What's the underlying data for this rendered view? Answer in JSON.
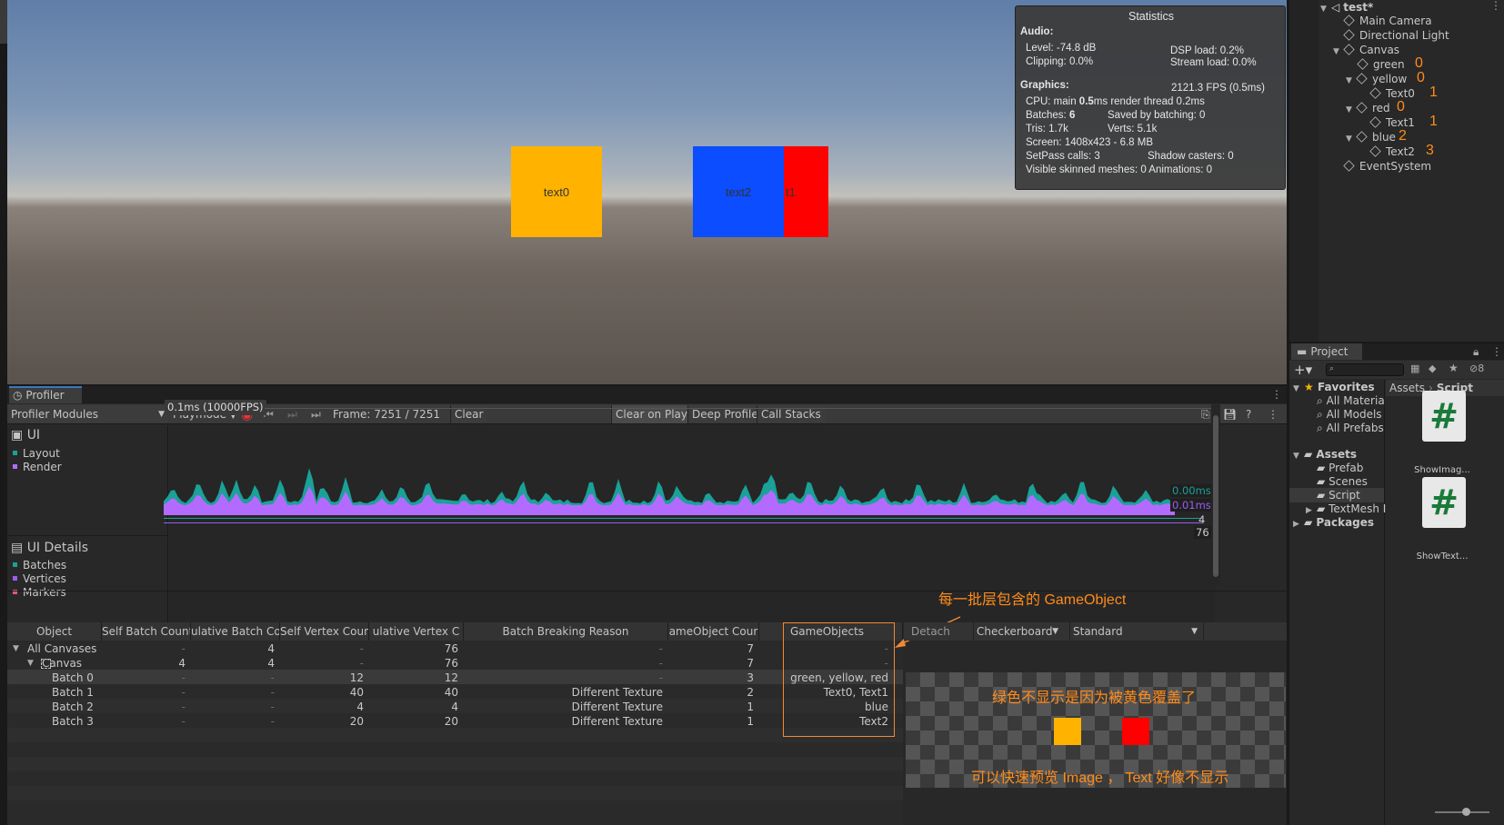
{
  "game": {
    "squares": [
      {
        "label": "text0",
        "color": "#ffb300"
      },
      {
        "label": "text2",
        "color": "#0b4dff"
      },
      {
        "label": "t1",
        "color": "#ff0000"
      }
    ]
  },
  "stats": {
    "title": "Statistics",
    "audio_header": "Audio:",
    "level": "Level: -74.8 dB",
    "clipping": "Clipping: 0.0%",
    "dsp": "DSP load: 0.2%",
    "stream": "Stream load: 0.0%",
    "graphics_header": "Graphics:",
    "fps": "2121.3 FPS (0.5ms)",
    "cpu_prefix": "CPU: main ",
    "cpu_main": "0.5",
    "cpu_suffix": "ms  render thread 0.2ms",
    "batches_prefix": "Batches: ",
    "batches_value": "6",
    "saved": "Saved by batching: 0",
    "tris": "Tris: 1.7k",
    "verts": "Verts: 5.1k",
    "screen": "Screen: 1408x423 - 6.8 MB",
    "setpass": "SetPass calls: 3",
    "shadow": "Shadow casters: 0",
    "skinned": "Visible skinned meshes: 0  Animations: 0"
  },
  "hierarchy": {
    "scene": "test*",
    "items": [
      {
        "label": "Main Camera"
      },
      {
        "label": "Directional Light"
      },
      {
        "label": "Canvas"
      },
      {
        "label": "green",
        "note": "0"
      },
      {
        "label": "yellow",
        "note": "0"
      },
      {
        "label": "Text0",
        "note": "1"
      },
      {
        "label": "red",
        "note": "0"
      },
      {
        "label": "Text1",
        "note": "1"
      },
      {
        "label": "blue",
        "note": "2"
      },
      {
        "label": "Text2",
        "note": "3"
      },
      {
        "label": "EventSystem"
      }
    ]
  },
  "project": {
    "tab": "Project",
    "badge": "8",
    "breadcrumb": [
      "Assets",
      "Script"
    ],
    "tree": [
      "Favorites",
      "All Materia",
      "All Models",
      "All Prefabs",
      "Assets",
      "Prefab",
      "Scenes",
      "Script",
      "TextMesh I",
      "Packages"
    ],
    "files": [
      "ShowImag...",
      "ShowText..."
    ]
  },
  "profiler": {
    "tab": "Profiler",
    "modules_label": "Profiler Modules",
    "playmode": "Playmode",
    "frame": "Frame: 7251 / 7251",
    "clear": "Clear",
    "clear_on_play": "Clear on Play",
    "deep_profile": "Deep Profile",
    "call_stacks": "Call Stacks",
    "fps_tag": "0.1ms (10000FPS)",
    "ui_module": "UI",
    "ui_series": [
      "Layout",
      "Render"
    ],
    "details_module": "UI Details",
    "details_series": [
      "Batches",
      "Vertices",
      "Markers"
    ],
    "chart_readouts": [
      "0.00ms",
      "0.01ms",
      "4",
      "76"
    ],
    "colors": {
      "layout": "#1aa198",
      "render": "#b36bff",
      "batches": "#1aa198",
      "vertices": "#9c5cf0",
      "markers": "#e0567b"
    }
  },
  "table": {
    "headers": [
      "Object",
      "Self Batch Count",
      "ulative Batch Co",
      "Self Vertex Coun",
      "ulative Vertex C",
      "Batch Breaking Reason",
      "ameObject Cour",
      "GameObjects"
    ],
    "rows": [
      {
        "name": "All Canvases",
        "c1": "-",
        "c2": "4",
        "c3": "-",
        "c4": "76",
        "reason": "-",
        "goc": "7",
        "go": "-"
      },
      {
        "name": "Canvas",
        "c1": "4",
        "c2": "4",
        "c3": "-",
        "c4": "76",
        "reason": "-",
        "goc": "7",
        "go": "-"
      },
      {
        "name": "Batch 0",
        "c1": "-",
        "c2": "-",
        "c3": "12",
        "c4": "12",
        "reason": "-",
        "goc": "3",
        "go": "green, yellow, red"
      },
      {
        "name": "Batch 1",
        "c1": "-",
        "c2": "-",
        "c3": "40",
        "c4": "40",
        "reason": "Different Texture",
        "goc": "2",
        "go": "Text0, Text1"
      },
      {
        "name": "Batch 2",
        "c1": "-",
        "c2": "-",
        "c3": "4",
        "c4": "4",
        "reason": "Different Texture",
        "goc": "1",
        "go": "blue"
      },
      {
        "name": "Batch 3",
        "c1": "-",
        "c2": "-",
        "c3": "20",
        "c4": "20",
        "reason": "Different Texture",
        "goc": "1",
        "go": "Text2"
      }
    ]
  },
  "preview": {
    "detach": "Detach",
    "background": "Checkerboard",
    "mode": "Standard"
  },
  "annotations": {
    "gameobjects_note": "每一批层包含的 GameObject",
    "green_note": "绿色不显示是因为被黄色覆盖了",
    "preview_note": "可以快速预览 Image ， Text 好像不显示"
  }
}
